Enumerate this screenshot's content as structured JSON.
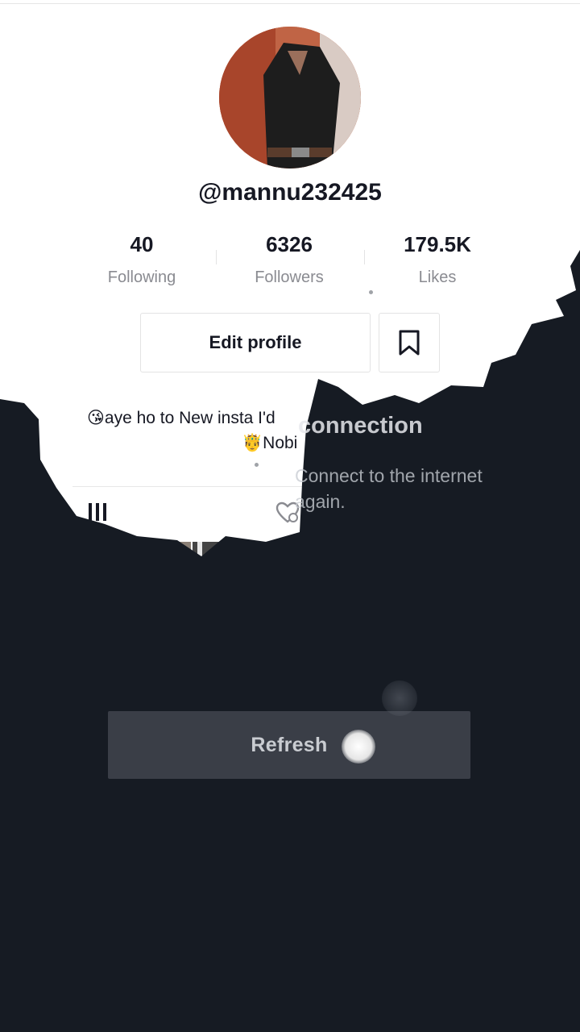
{
  "profile": {
    "username": "@mannu232425",
    "bio_line1": "😘aye ho to New insta I'd",
    "bio_line2": "🤴Nobi"
  },
  "stats": [
    {
      "value": "40",
      "label": "Following"
    },
    {
      "value": "6326",
      "label": "Followers"
    },
    {
      "value": "179.5K",
      "label": "Likes"
    }
  ],
  "actions": {
    "edit_profile": "Edit profile"
  },
  "overlay": {
    "title": "connection",
    "message": "Connect to the internet again.",
    "refresh": "Refresh"
  },
  "icons": {
    "bookmark": "bookmark-icon",
    "grid": "grid-icon",
    "liked": "liked-hidden-icon"
  }
}
